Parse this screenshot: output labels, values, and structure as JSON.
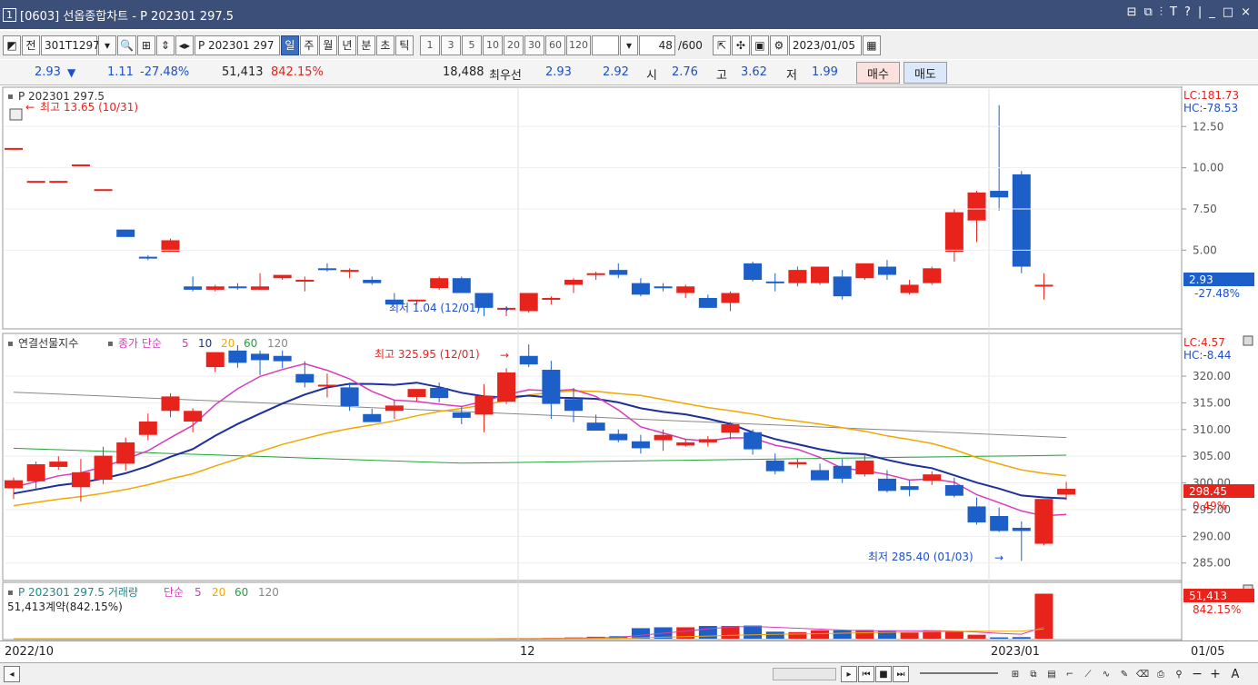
{
  "window": {
    "number": "1",
    "title": "[0603] 선옵종합차트 - P 202301 297.5",
    "controls": [
      "⊟",
      "⧉",
      "⫶",
      "T",
      "?",
      "|",
      "_",
      "□",
      "×"
    ]
  },
  "toolbar": {
    "prev_label": "전",
    "code": "301T1297",
    "name": "P 202301 297",
    "periods": [
      "일",
      "주",
      "월",
      "년",
      "분",
      "초",
      "틱"
    ],
    "selected_period": "일",
    "intervals": [
      "1",
      "3",
      "5",
      "10",
      "20",
      "30",
      "60",
      "120"
    ],
    "count": "48",
    "total": "/600",
    "date": "2023/01/05"
  },
  "quote": {
    "price": "2.93",
    "arrow": "▼",
    "change": "1.11",
    "change_pct": "-27.48%",
    "volume": "51,413",
    "volume_pct": "842.15%",
    "open_interest": "18,488",
    "best_label": "최우선",
    "best_ask": "2.93",
    "best_bid": "2.92",
    "open_label": "시",
    "open": "2.76",
    "high_label": "고",
    "high": "3.62",
    "low_label": "저",
    "low": "1.99",
    "buy_label": "매수",
    "sell_label": "매도"
  },
  "price_pane": {
    "legend": "P 202301 297.5",
    "lc": "LC:181.73",
    "hc": "HC:-78.53",
    "high_note": "최고 13.65 (10/31)",
    "low_note": "최저 1.04 (12/01)",
    "last_value": "2.93",
    "last_pct": "-27.48%",
    "axis_labels": [
      "12.50",
      "10.00",
      "7.50",
      "5.00"
    ]
  },
  "index_pane": {
    "legend_name": "연결선물지수",
    "legend_ma": "종가 단순",
    "ma_periods": [
      "5",
      "10",
      "20",
      "60",
      "120"
    ],
    "lc": "LC:4.57",
    "hc": "HC:-8.44",
    "high_note": "최고 325.95 (12/01)",
    "low_note": "최저 285.40 (01/03)",
    "last_value": "298.45",
    "last_pct": "0.49%",
    "axis_labels": [
      "320.00",
      "315.00",
      "310.00",
      "305.00",
      "300.00",
      "295.00",
      "290.00",
      "285.00"
    ]
  },
  "volume_pane": {
    "legend_name": "P 202301 297.5 거래량",
    "legend_ma": "단순",
    "ma_periods": [
      "5",
      "20",
      "60",
      "120"
    ],
    "note": "51,413계약(842.15%)",
    "last_value": "51,413",
    "last_pct": "842.15%"
  },
  "xaxis": {
    "labels": [
      "2022/10",
      "12",
      "2023/01",
      "01/05"
    ]
  },
  "colors": {
    "up": "#e8231c",
    "down": "#1d5fc8",
    "ma5": "#d83cbb",
    "ma10": "#1c2f9c",
    "ma20": "#f0a800",
    "ma60": "#22a33a",
    "ma120": "#888888",
    "titlebar": "#3c4f78"
  },
  "chart_data": [
    {
      "type": "candlestick",
      "title": "P 202301 297.5",
      "ylim": [
        0.5,
        14.5
      ],
      "candles": [
        [
          11.2,
          11.2,
          11.2,
          11.2
        ],
        [
          9.2,
          9.2,
          9.2,
          9.2
        ],
        [
          9.2,
          9.2,
          9.2,
          9.2
        ],
        [
          10.2,
          10.2,
          10.2,
          10.2
        ],
        [
          8.7,
          8.7,
          8.7,
          8.7
        ],
        [
          6.25,
          6.25,
          5.8,
          5.8
        ],
        [
          4.6,
          4.7,
          4.4,
          4.5
        ],
        [
          4.9,
          5.7,
          4.9,
          5.6
        ],
        [
          2.8,
          3.4,
          2.5,
          2.6
        ],
        [
          2.6,
          2.9,
          2.5,
          2.8
        ],
        [
          2.8,
          3.0,
          2.6,
          2.7
        ],
        [
          2.6,
          3.6,
          2.6,
          2.8
        ],
        [
          3.3,
          3.4,
          3.2,
          3.5
        ],
        [
          3.2,
          3.4,
          2.5,
          3.2
        ],
        [
          3.9,
          4.2,
          3.7,
          3.8
        ],
        [
          3.8,
          3.9,
          3.3,
          3.8
        ],
        [
          3.2,
          3.4,
          2.9,
          3.0
        ],
        [
          2.0,
          2.4,
          1.8,
          1.7
        ],
        [
          1.9,
          2.0,
          1.7,
          2.0
        ],
        [
          2.7,
          3.4,
          2.6,
          3.3
        ],
        [
          3.3,
          3.4,
          2.4,
          2.4
        ],
        [
          2.4,
          2.4,
          1.0,
          1.5
        ],
        [
          1.5,
          1.6,
          1.0,
          1.5
        ],
        [
          1.3,
          2.4,
          1.2,
          2.4
        ],
        [
          2.0,
          2.2,
          1.7,
          2.1
        ],
        [
          2.9,
          3.3,
          2.4,
          3.2
        ],
        [
          3.5,
          3.7,
          3.2,
          3.6
        ],
        [
          3.8,
          4.2,
          3.3,
          3.5
        ],
        [
          3.0,
          3.3,
          2.2,
          2.3
        ],
        [
          2.8,
          3.0,
          2.5,
          2.7
        ],
        [
          2.4,
          2.9,
          2.1,
          2.8
        ],
        [
          2.1,
          2.3,
          1.5,
          1.5
        ],
        [
          1.8,
          2.5,
          1.3,
          2.4
        ],
        [
          4.2,
          4.3,
          3.1,
          3.2
        ],
        [
          3.1,
          3.6,
          2.5,
          3.0
        ],
        [
          3.0,
          4.0,
          2.8,
          3.8
        ],
        [
          3.0,
          4.0,
          2.9,
          4.0
        ],
        [
          3.4,
          3.8,
          2.0,
          2.2
        ],
        [
          3.3,
          4.2,
          3.2,
          4.2
        ],
        [
          4.0,
          4.4,
          3.2,
          3.5
        ],
        [
          2.4,
          3.2,
          2.3,
          2.9
        ],
        [
          3.0,
          4.0,
          2.9,
          3.9
        ],
        [
          4.9,
          7.5,
          4.3,
          7.3
        ],
        [
          6.8,
          8.6,
          5.5,
          8.5
        ],
        [
          8.6,
          13.8,
          7.4,
          8.2
        ],
        [
          9.6,
          9.8,
          3.6,
          4.0
        ],
        [
          2.9,
          3.6,
          2.0,
          2.9
        ]
      ]
    },
    {
      "type": "candlestick",
      "title": "연결선물지수",
      "ylim": [
        282.4,
        327.5
      ],
      "candles": [
        [
          299,
          301,
          297,
          300.5
        ],
        [
          300.3,
          304.0,
          298.8,
          303.5
        ],
        [
          303,
          305,
          302.5,
          304
        ],
        [
          299.2,
          304.5,
          296.5,
          302.0
        ],
        [
          300.6,
          306.8,
          299.8,
          305.1
        ],
        [
          303.6,
          308.5,
          302.3,
          307.6
        ],
        [
          309,
          313,
          308,
          311.5
        ],
        [
          313.5,
          316.8,
          312.3,
          316.2
        ],
        [
          311.5,
          314.0,
          309.5,
          313.5
        ],
        [
          321.7,
          324.2,
          320.8,
          324.5
        ],
        [
          324.8,
          325.8,
          321.6,
          322.5
        ],
        [
          324.2,
          324.8,
          320.2,
          323.0
        ],
        [
          323.8,
          324.8,
          321.5,
          322.8
        ],
        [
          320.4,
          322.8,
          317.9,
          318.8
        ],
        [
          318.3,
          320.5,
          316.0,
          318.4
        ],
        [
          317.9,
          318.8,
          313.5,
          314.4
        ],
        [
          312.9,
          313.9,
          311.5,
          311.4
        ],
        [
          313.5,
          315.5,
          312.0,
          314.5
        ],
        [
          316.1,
          317.5,
          315.2,
          317.6
        ],
        [
          317.8,
          318.8,
          315.1,
          315.9
        ],
        [
          313.2,
          314.4,
          311.0,
          312.2
        ],
        [
          312.8,
          318.5,
          309.5,
          316.3
        ],
        [
          315.2,
          321.5,
          314.8,
          320.7
        ],
        [
          323.8,
          325.95,
          321.7,
          322.2
        ],
        [
          321.2,
          322.9,
          312.0,
          314.8
        ],
        [
          315.7,
          317.8,
          311.4,
          313.5
        ],
        [
          311.3,
          312.8,
          310.0,
          309.8
        ],
        [
          309.2,
          310.0,
          307.6,
          308.0
        ],
        [
          307.8,
          309.0,
          305.5,
          306.5
        ],
        [
          308.0,
          310.0,
          306.0,
          309.0
        ],
        [
          307.0,
          308.2,
          306.8,
          307.6
        ],
        [
          307.6,
          308.8,
          306.8,
          308.2
        ],
        [
          309.4,
          311.4,
          308.2,
          311.0
        ],
        [
          309.5,
          310.0,
          305.3,
          306.3
        ],
        [
          304.2,
          305.5,
          301.6,
          302.2
        ],
        [
          303.5,
          304.5,
          302.8,
          303.9
        ],
        [
          302.4,
          303.6,
          300.7,
          300.5
        ],
        [
          303.2,
          304.5,
          300.0,
          300.8
        ],
        [
          301.6,
          305.6,
          301.2,
          304.2
        ],
        [
          300.8,
          302.4,
          298.2,
          298.5
        ],
        [
          299.4,
          300.5,
          297.5,
          298.7
        ],
        [
          300.4,
          302.2,
          299.6,
          301.6
        ],
        [
          299.6,
          301.0,
          297.3,
          297.6
        ],
        [
          295.6,
          297.3,
          292.2,
          292.6
        ],
        [
          293.8,
          295.4,
          290.8,
          291.0
        ],
        [
          291.6,
          292.8,
          285.4,
          291.0
        ],
        [
          288.6,
          296.9,
          288.3,
          297.0
        ],
        [
          297.8,
          300.2,
          296.8,
          298.9
        ]
      ]
    },
    {
      "type": "bar",
      "title": "P 202301 297.5 거래량",
      "values": [
        0,
        0,
        0,
        0,
        0,
        0,
        0,
        0,
        0,
        0,
        0,
        0,
        0,
        0,
        0,
        0,
        0,
        0,
        0,
        0,
        0,
        0,
        300,
        300,
        800,
        1400,
        2200,
        2800,
        12000,
        13000,
        13000,
        14500,
        14500,
        15000,
        8000,
        7500,
        9500,
        9500,
        10000,
        9000,
        7000,
        9500,
        8000,
        4500,
        1500,
        1800,
        51413
      ],
      "ylim": [
        0,
        54000
      ]
    }
  ]
}
